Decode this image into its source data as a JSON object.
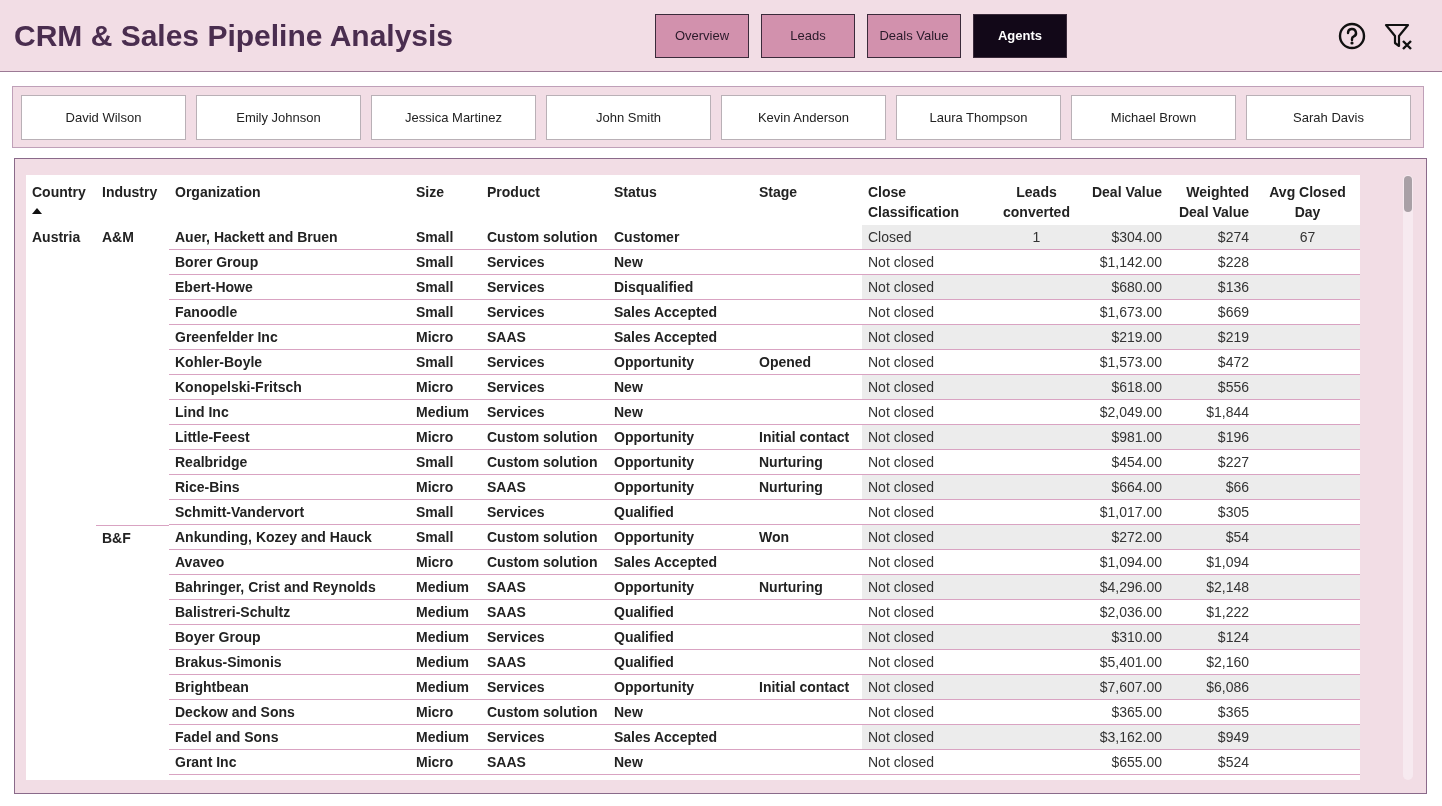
{
  "title": "CRM & Sales Pipeline Analysis",
  "nav": [
    {
      "label": "Overview",
      "selected": false
    },
    {
      "label": "Leads",
      "selected": false
    },
    {
      "label": "Deals Value",
      "selected": false
    },
    {
      "label": "Agents",
      "selected": true
    }
  ],
  "agents": [
    "David Wilson",
    "Emily Johnson",
    "Jessica Martinez",
    "John Smith",
    "Kevin Anderson",
    "Laura Thompson",
    "Michael Brown",
    "Sarah Davis"
  ],
  "table": {
    "columns": [
      {
        "label": "Country",
        "sorted": true
      },
      {
        "label": "Industry",
        "sorted": false
      },
      {
        "label": "Organization",
        "sorted": false
      },
      {
        "label": "Size",
        "sorted": false
      },
      {
        "label": "Product",
        "sorted": false
      },
      {
        "label": "Status",
        "sorted": false
      },
      {
        "label": "Stage",
        "sorted": false
      },
      {
        "label": "Close Classification",
        "sorted": false
      },
      {
        "label": "Leads converted",
        "sorted": false
      },
      {
        "label": "Deal Value",
        "sorted": false
      },
      {
        "label": "Weighted Deal Value",
        "sorted": false
      },
      {
        "label": "Avg Closed Day",
        "sorted": false
      }
    ],
    "countries": [
      {
        "name": "Austria",
        "industries": [
          {
            "name": "A&M",
            "rows": [
              {
                "organization": "Auer, Hackett and Bruen",
                "size": "Small",
                "product": "Custom solution",
                "status": "Customer",
                "close": "Closed",
                "leads": "1",
                "deal": "$304.00",
                "weighted": "$274",
                "avg": "67"
              },
              {
                "organization": "Borer Group",
                "size": "Small",
                "product": "Services",
                "status": "New",
                "close": "Not closed",
                "deal": "$1,142.00",
                "weighted": "$228"
              },
              {
                "organization": "Ebert-Howe",
                "size": "Small",
                "product": "Services",
                "status": "Disqualified",
                "close": "Not closed",
                "deal": "$680.00",
                "weighted": "$136"
              },
              {
                "organization": "Fanoodle",
                "size": "Small",
                "product": "Services",
                "status": "Sales Accepted",
                "close": "Not closed",
                "deal": "$1,673.00",
                "weighted": "$669"
              },
              {
                "organization": "Greenfelder Inc",
                "size": "Micro",
                "product": "SAAS",
                "status": "Sales Accepted",
                "close": "Not closed",
                "deal": "$219.00",
                "weighted": "$219"
              },
              {
                "organization": "Kohler-Boyle",
                "size": "Small",
                "product": "Services",
                "status": "Opportunity",
                "stage": "Opened",
                "close": "Not closed",
                "deal": "$1,573.00",
                "weighted": "$472"
              },
              {
                "organization": "Konopelski-Fritsch",
                "size": "Micro",
                "product": "Services",
                "status": "New",
                "close": "Not closed",
                "deal": "$618.00",
                "weighted": "$556"
              },
              {
                "organization": "Lind Inc",
                "size": "Medium",
                "product": "Services",
                "status": "New",
                "close": "Not closed",
                "deal": "$2,049.00",
                "weighted": "$1,844"
              },
              {
                "organization": "Little-Feest",
                "size": "Micro",
                "product": "Custom solution",
                "status": "Opportunity",
                "stage": "Initial contact",
                "close": "Not closed",
                "deal": "$981.00",
                "weighted": "$196"
              },
              {
                "organization": "Realbridge",
                "size": "Small",
                "product": "Custom solution",
                "status": "Opportunity",
                "stage": "Nurturing",
                "close": "Not closed",
                "deal": "$454.00",
                "weighted": "$227"
              },
              {
                "organization": "Rice-Bins",
                "size": "Micro",
                "product": "SAAS",
                "status": "Opportunity",
                "stage": "Nurturing",
                "close": "Not closed",
                "deal": "$664.00",
                "weighted": "$66"
              },
              {
                "organization": "Schmitt-Vandervort",
                "size": "Small",
                "product": "Services",
                "status": "Qualified",
                "close": "Not closed",
                "deal": "$1,017.00",
                "weighted": "$305"
              }
            ]
          },
          {
            "name": "B&F",
            "rows": [
              {
                "organization": "Ankunding, Kozey and Hauck",
                "size": "Small",
                "product": "Custom solution",
                "status": "Opportunity",
                "stage": "Won",
                "close": "Not closed",
                "deal": "$272.00",
                "weighted": "$54"
              },
              {
                "organization": "Avaveo",
                "size": "Micro",
                "product": "Custom solution",
                "status": "Sales Accepted",
                "close": "Not closed",
                "deal": "$1,094.00",
                "weighted": "$1,094"
              },
              {
                "organization": "Bahringer, Crist and Reynolds",
                "size": "Medium",
                "product": "SAAS",
                "status": "Opportunity",
                "stage": "Nurturing",
                "close": "Not closed",
                "deal": "$4,296.00",
                "weighted": "$2,148"
              },
              {
                "organization": "Balistreri-Schultz",
                "size": "Medium",
                "product": "SAAS",
                "status": "Qualified",
                "close": "Not closed",
                "deal": "$2,036.00",
                "weighted": "$1,222"
              },
              {
                "organization": "Boyer Group",
                "size": "Medium",
                "product": "Services",
                "status": "Qualified",
                "close": "Not closed",
                "deal": "$310.00",
                "weighted": "$124"
              },
              {
                "organization": "Brakus-Simonis",
                "size": "Medium",
                "product": "SAAS",
                "status": "Qualified",
                "close": "Not closed",
                "deal": "$5,401.00",
                "weighted": "$2,160"
              },
              {
                "organization": "Brightbean",
                "size": "Medium",
                "product": "Services",
                "status": "Opportunity",
                "stage": "Initial contact",
                "close": "Not closed",
                "deal": "$7,607.00",
                "weighted": "$6,086"
              },
              {
                "organization": "Deckow and Sons",
                "size": "Micro",
                "product": "Custom solution",
                "status": "New",
                "close": "Not closed",
                "deal": "$365.00",
                "weighted": "$365"
              },
              {
                "organization": "Fadel and Sons",
                "size": "Medium",
                "product": "Services",
                "status": "Sales Accepted",
                "close": "Not closed",
                "deal": "$3,162.00",
                "weighted": "$949"
              },
              {
                "organization": "Grant Inc",
                "size": "Micro",
                "product": "SAAS",
                "status": "New",
                "close": "Not closed",
                "deal": "$655.00",
                "weighted": "$524"
              }
            ]
          }
        ]
      }
    ]
  }
}
